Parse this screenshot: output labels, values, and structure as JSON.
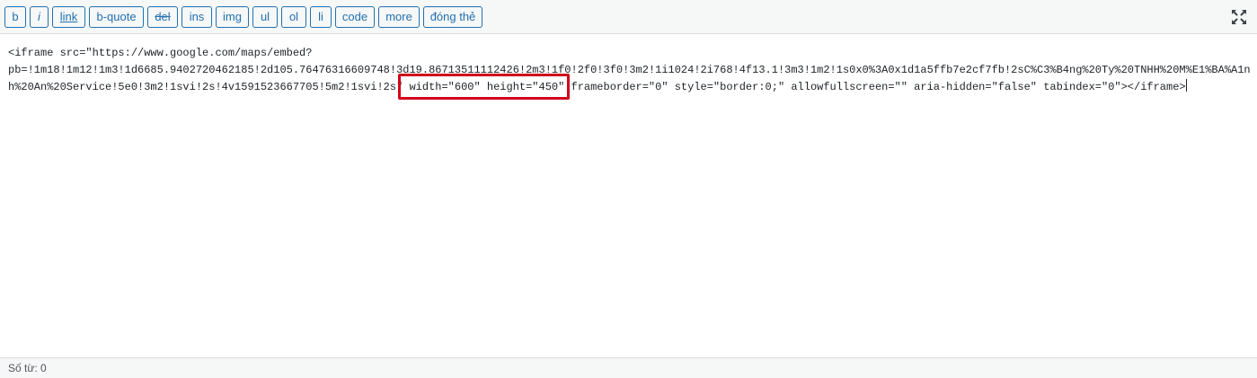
{
  "toolbar": {
    "buttons": [
      {
        "label": "b"
      },
      {
        "label": "i"
      },
      {
        "label": "link"
      },
      {
        "label": "b-quote"
      },
      {
        "label": "del"
      },
      {
        "label": "ins"
      },
      {
        "label": "img"
      },
      {
        "label": "ul"
      },
      {
        "label": "ol"
      },
      {
        "label": "li"
      },
      {
        "label": "code"
      },
      {
        "label": "more"
      },
      {
        "label": "đóng thẻ"
      }
    ],
    "fullscreen_icon": "fullscreen-icon"
  },
  "editor": {
    "lines": [
      "<iframe src=\"https://www.google.com/maps/embed?",
      "pb=!1m18!1m12!1m3!1d6685.9402720462185!2d105.76476316609748!3d19.86713511112426!2m3!1f0!2f0!3f0!3m2!1i1024!2i768!4f13.1!3m3!1m2!1s0x0%3A0x1d1a5ffb7e2cf7fb!2sC%C3%B4ng%20Ty%20TNHH%20M%E1%BA%A1n",
      "h%20An%20Service!5e0!3m2!1svi!2s!4v1591523667705!5m2!1svi!2s\" width=\"600\" height=\"450\" frameborder=\"0\" style=\"border:0;\" allowfullscreen=\"\" aria-hidden=\"false\" tabindex=\"0\"></iframe>"
    ],
    "highlight_color": "#d0021b"
  },
  "status": {
    "word_count": "Số từ: 0"
  },
  "colors": {
    "accent": "#2271b1",
    "toolbar_bg": "#f6f7f7",
    "border": "#dcdcde"
  }
}
